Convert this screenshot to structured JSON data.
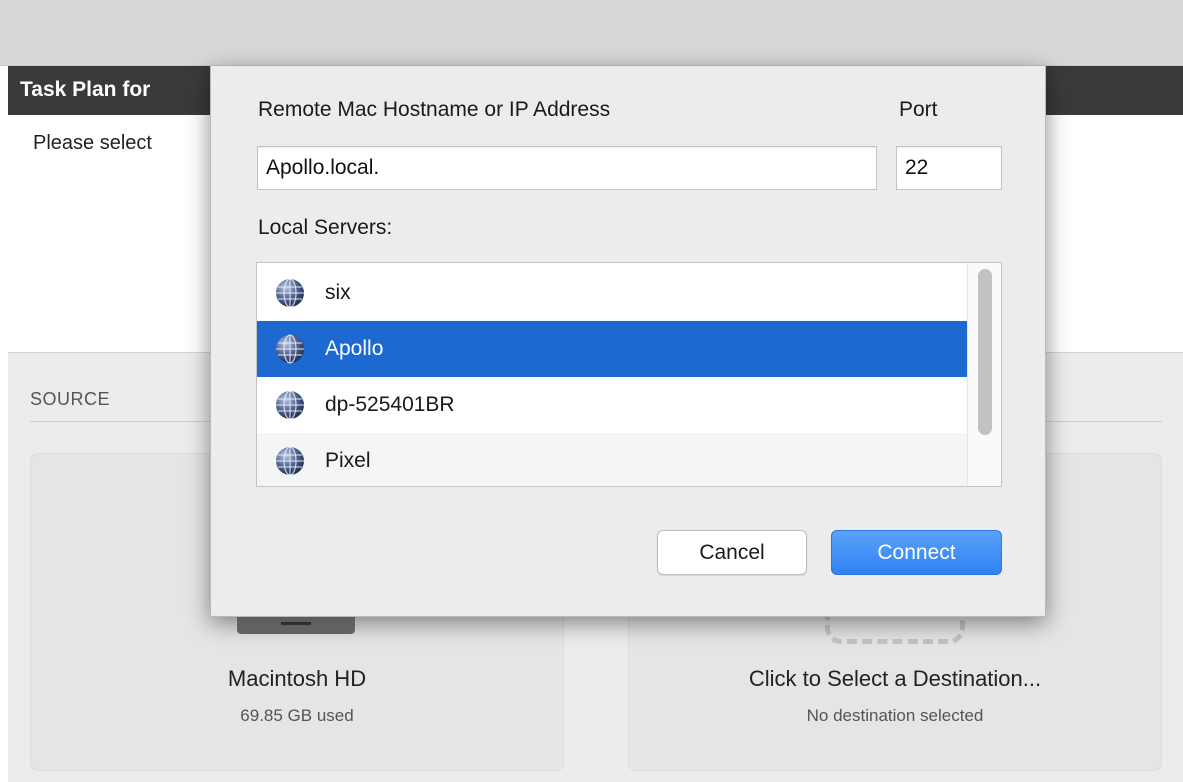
{
  "window": {
    "header_title": "Task Plan for",
    "prompt_text": "Please select"
  },
  "background": {
    "section_label": "SOURCE",
    "source_card": {
      "name": "Macintosh HD",
      "sub": "69.85 GB used"
    },
    "destination_card": {
      "name": "Click to Select a Destination...",
      "sub": "No destination selected"
    }
  },
  "dialog": {
    "hostname_label": "Remote Mac Hostname or IP Address",
    "port_label": "Port",
    "hostname_value": "Apollo.local.",
    "port_value": "22",
    "servers_label": "Local Servers:",
    "servers": [
      {
        "label": "six",
        "icon": "network-globe-icon"
      },
      {
        "label": "Apollo",
        "icon": "network-globe-icon",
        "selected": true
      },
      {
        "label": "dp-525401BR",
        "icon": "network-globe-icon"
      },
      {
        "label": "Pixel",
        "icon": "network-globe-icon"
      }
    ],
    "cancel_label": "Cancel",
    "connect_label": "Connect"
  },
  "colors": {
    "selection": "#1d69d2",
    "primary_button": "#2f82f2",
    "header_bar": "#3a3a3a"
  }
}
